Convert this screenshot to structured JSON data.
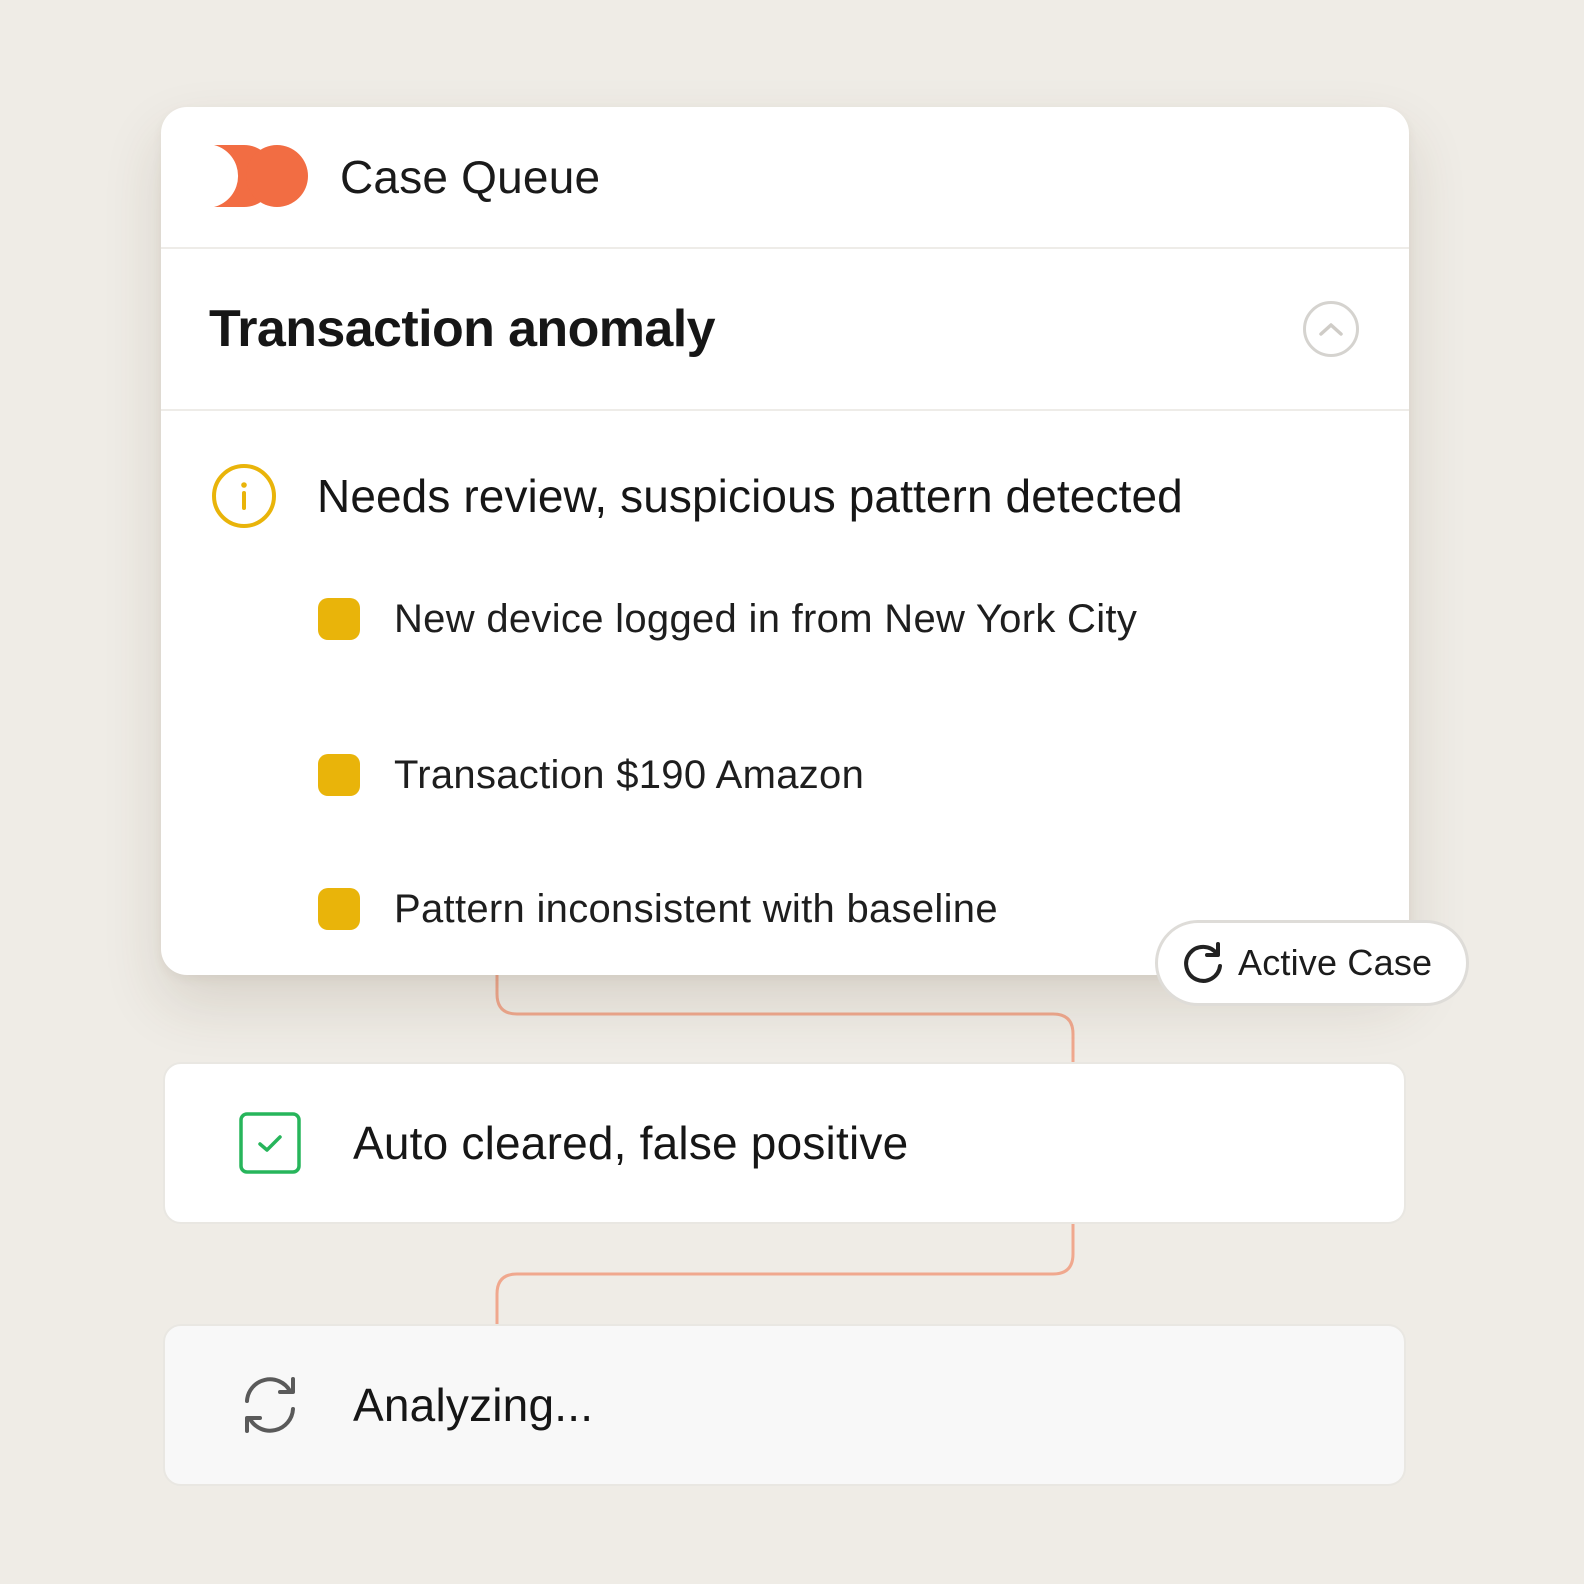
{
  "app": {
    "title": "Case Queue",
    "logo_icon": "brand-logo-icon"
  },
  "case": {
    "title": "Transaction anomaly",
    "collapse_icon": "chevron-up-icon",
    "status": {
      "icon": "info-icon",
      "text": "Needs review, suspicious pattern detected"
    },
    "reasons": [
      {
        "label": "New device logged in from New York City"
      },
      {
        "label": "Transaction $190 Amazon"
      },
      {
        "label": "Pattern inconsistent with baseline"
      }
    ]
  },
  "badge": {
    "icon": "refresh-icon",
    "label": "Active Case"
  },
  "steps": [
    {
      "icon": "check-box-icon",
      "label": "Auto cleared, false positive"
    },
    {
      "icon": "sync-icon",
      "label": "Analyzing..."
    }
  ],
  "colors": {
    "background": "#efece6",
    "brand": "#f26d43",
    "warning": "#e9b40a",
    "success": "#27b55b",
    "connector": "#f0a88e"
  }
}
